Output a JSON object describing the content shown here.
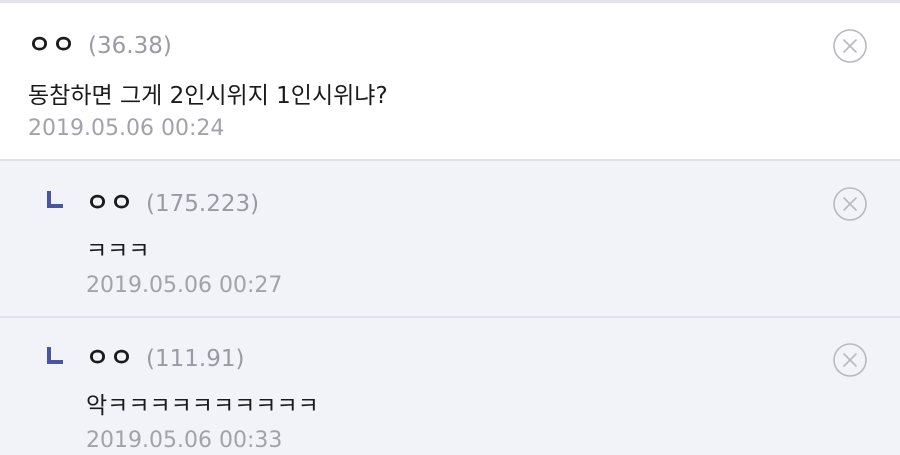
{
  "comments": [
    {
      "author": "ㅇㅇ",
      "ip": "(36.38)",
      "text": "동참하면 그게 2인시위지 1인시위냐?",
      "timestamp": "2019.05.06 00:24",
      "is_reply": false
    },
    {
      "author": "ㅇㅇ",
      "ip": "(175.223)",
      "text": "ㅋㅋㅋ",
      "timestamp": "2019.05.06 00:27",
      "is_reply": true
    },
    {
      "author": "ㅇㅇ",
      "ip": "(111.91)",
      "text": "악ㅋㅋㅋㅋㅋㅋㅋㅋㅋㅋ",
      "timestamp": "2019.05.06 00:33",
      "is_reply": true
    }
  ],
  "icons": {
    "delete": "close-circle-icon",
    "reply": "reply-arrow-icon"
  },
  "colors": {
    "reply_background": "#f2f3f9",
    "reply_arrow": "#4a55a2",
    "ip_text": "#9a9aa4",
    "timestamp_text": "#a2a2aa"
  }
}
